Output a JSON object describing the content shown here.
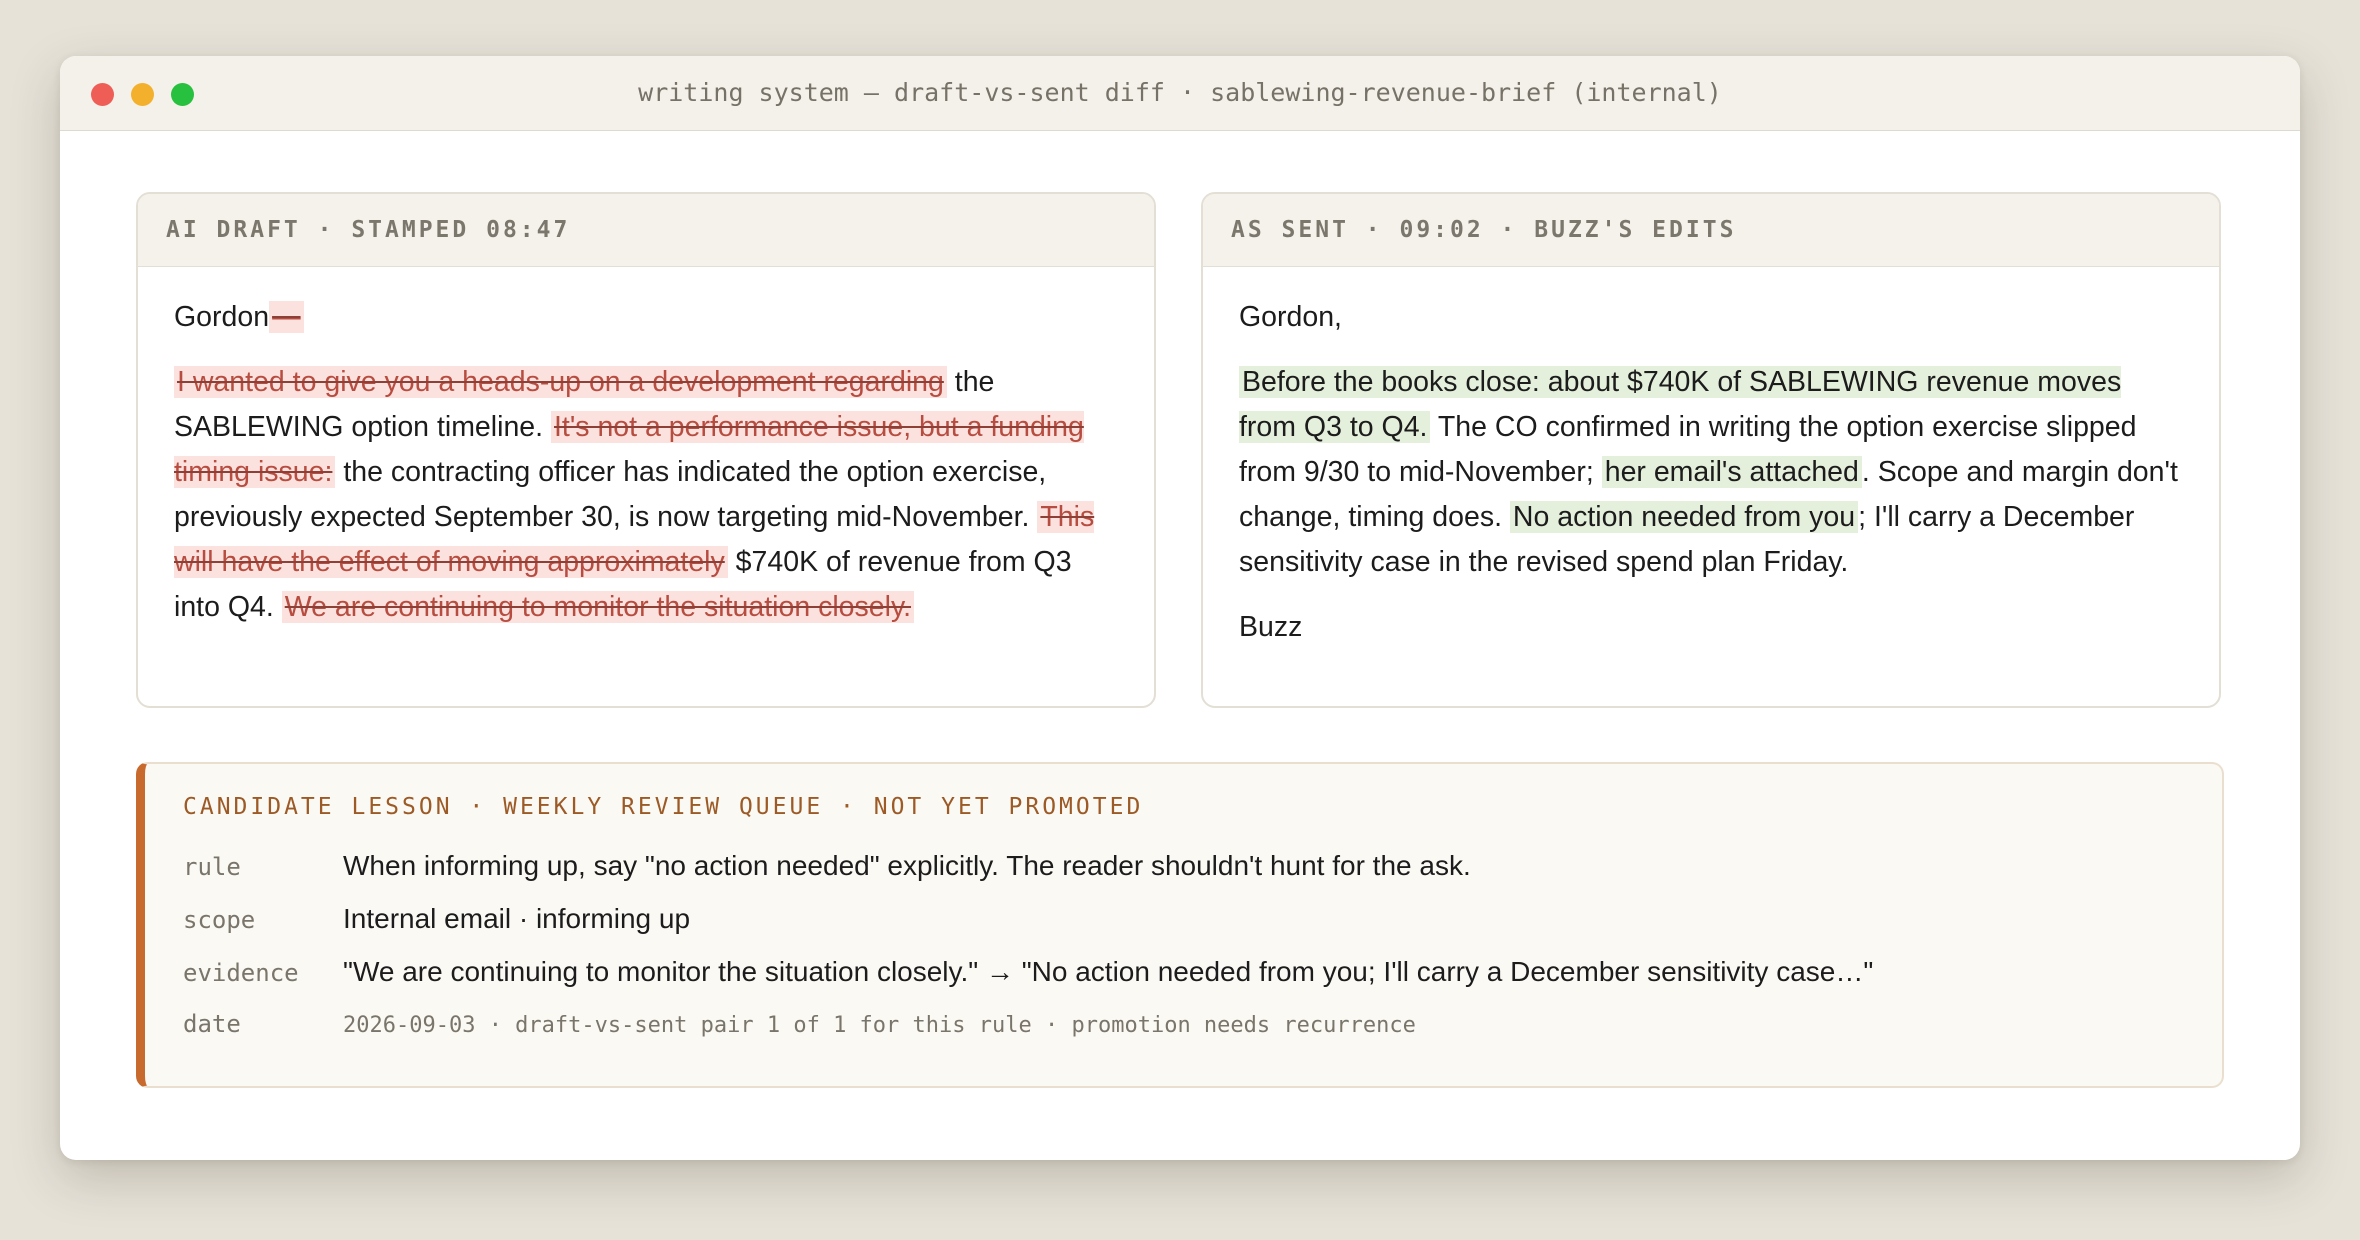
{
  "window": {
    "title": "writing system — draft-vs-sent diff · sablewing-revenue-brief (internal)"
  },
  "draft": {
    "header": "AI DRAFT · STAMPED 08:47",
    "greeting": "Gordon",
    "greeting_deleted": "—",
    "segments": [
      {
        "type": "del",
        "text": "I wanted to give you a heads-up on a development regarding"
      },
      {
        "type": "text",
        "text": " the SABLEWING option timeline. "
      },
      {
        "type": "del",
        "text": "It's not a performance issue, but a funding timing issue:"
      },
      {
        "type": "text",
        "text": " the contracting officer has indicated the option exercise, previously expected September 30, is now targeting mid-November. "
      },
      {
        "type": "del",
        "text": "This will have the effect of moving approximately"
      },
      {
        "type": "text",
        "text": " $740K of revenue from Q3 into Q4. "
      },
      {
        "type": "del",
        "text": "We are continuing to monitor the situation closely."
      }
    ]
  },
  "sent": {
    "header": "AS SENT · 09:02 · BUZZ'S EDITS",
    "greeting": "Gordon,",
    "segments": [
      {
        "type": "ins",
        "text": "Before the books close: about $740K of SABLEWING revenue moves from Q3 to Q4."
      },
      {
        "type": "text",
        "text": " The CO confirmed in writing the option exercise slipped from 9/30 to mid-November; "
      },
      {
        "type": "ins",
        "text": "her email's attached"
      },
      {
        "type": "text",
        "text": ". Scope and margin don't change, timing does. "
      },
      {
        "type": "ins",
        "text": "No action needed from you"
      },
      {
        "type": "text",
        "text": "; I'll carry a December sensitivity case in the revised spend plan Friday."
      }
    ],
    "signoff": "Buzz"
  },
  "lesson": {
    "header": "CANDIDATE LESSON · WEEKLY REVIEW QUEUE · NOT YET PROMOTED",
    "rule_label": "rule",
    "rule": "When informing up, say \"no action needed\" explicitly. The reader shouldn't hunt for the ask.",
    "scope_label": "scope",
    "scope": "Internal email · informing up",
    "evidence_label": "evidence",
    "evidence": "\"We are continuing to monitor the situation closely.\" → \"No action needed from you; I'll carry a December sensitivity case…\"",
    "date_label": "date",
    "date": "2026-09-03 · draft-vs-sent pair 1 of 1 for this rule · promotion needs recurrence"
  },
  "colors": {
    "deleted_bg": "#fbe2de",
    "deleted_text": "#b74d41",
    "inserted_bg": "#e5f0dc",
    "lesson_accent": "#c86a2e"
  }
}
